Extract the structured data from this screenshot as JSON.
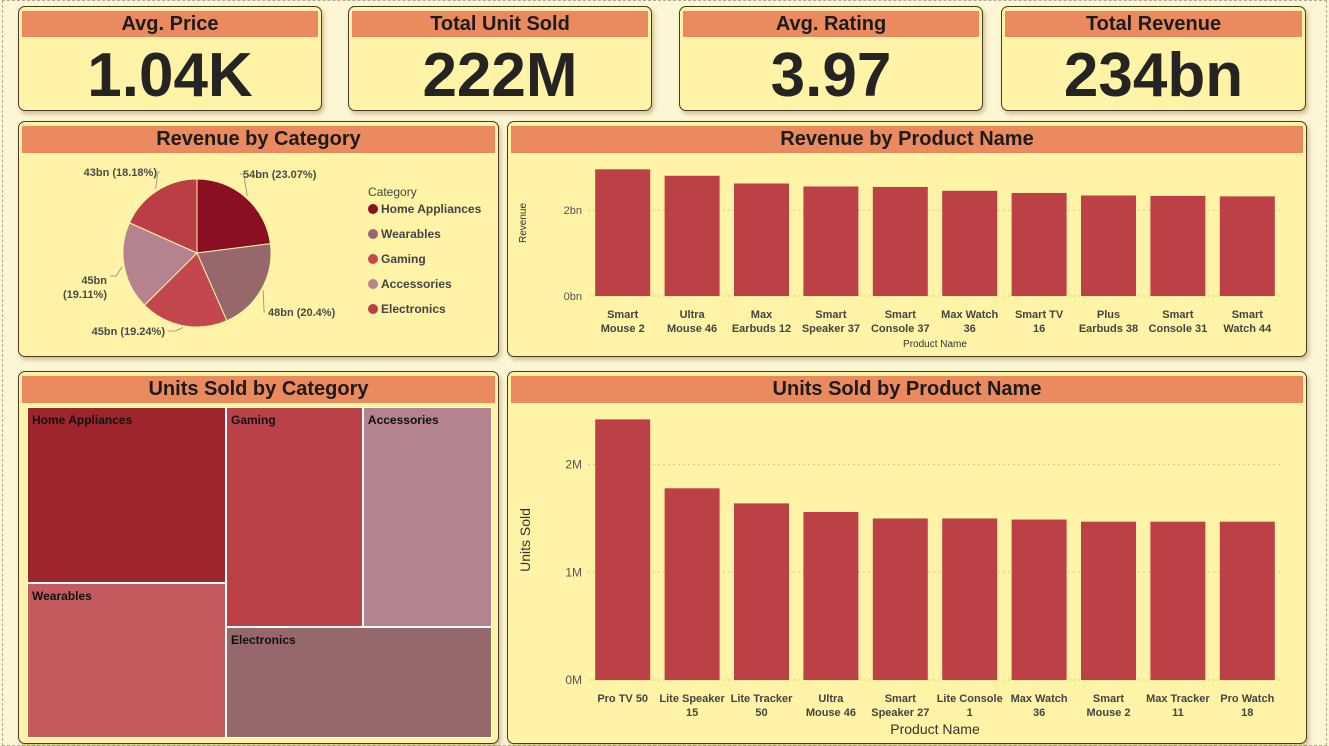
{
  "kpis": [
    {
      "title": "Avg. Price",
      "value": "1.04K"
    },
    {
      "title": "Total Unit Sold",
      "value": "222M"
    },
    {
      "title": "Avg. Rating",
      "value": "3.97"
    },
    {
      "title": "Total Revenue",
      "value": "234bn"
    }
  ],
  "colors": {
    "header": "#EA8A5E",
    "panel": "#FEF3A6",
    "background": "#FDF6D4",
    "bar": "#BC4147",
    "home_appliances": "#8B0F22",
    "wearables": "#96686B",
    "gaming": "#C2484E",
    "accessories": "#B4838E",
    "electronics": "#BA3E43"
  },
  "chart_data": [
    {
      "type": "pie",
      "title": "Revenue by Category",
      "legend_title": "Category",
      "legend_position": "right",
      "categories": [
        "Home Appliances",
        "Wearables",
        "Gaming",
        "Accessories",
        "Electronics"
      ],
      "values": [
        54,
        48,
        45,
        45,
        43
      ],
      "value_labels": [
        "54bn (23.07%)",
        "48bn (20.4%)",
        "45bn (19.24%)",
        "45bn (19.11%)",
        "43bn (18.18%)"
      ],
      "colors": [
        "#8B0F22",
        "#96686B",
        "#C2484E",
        "#B4838E",
        "#BA3E43"
      ]
    },
    {
      "type": "bar",
      "title": "Revenue by Product Name",
      "categories": [
        "Smart Mouse 2",
        "Ultra Mouse 46",
        "Max Earbuds 12",
        "Smart Speaker 37",
        "Smart Console 37",
        "Max Watch 36",
        "Smart TV 16",
        "Plus Earbuds 38",
        "Smart Console 31",
        "Smart Watch 44"
      ],
      "category_lines": [
        [
          "Smart",
          "Mouse 2"
        ],
        [
          "Ultra",
          "Mouse 46"
        ],
        [
          "Max",
          "Earbuds 12"
        ],
        [
          "Smart",
          "Speaker 37"
        ],
        [
          "Smart",
          "Console 37"
        ],
        [
          "Max Watch",
          "36"
        ],
        [
          "Smart TV",
          "16"
        ],
        [
          "Plus",
          "Earbuds 38"
        ],
        [
          "Smart",
          "Console 31"
        ],
        [
          "Smart",
          "Watch 44"
        ]
      ],
      "values": [
        2.95,
        2.8,
        2.62,
        2.55,
        2.54,
        2.45,
        2.4,
        2.34,
        2.33,
        2.32
      ],
      "unit": "bn",
      "xlabel": "Product Name",
      "ylabel": "Revenue",
      "yticks": [
        "0bn",
        "2bn"
      ],
      "ytick_values": [
        0,
        2
      ],
      "ylim": [
        0,
        3.4
      ],
      "grid": true
    },
    {
      "type": "heatmap",
      "subtype": "treemap",
      "title": "Units Sold by Category",
      "categories": [
        "Home Appliances",
        "Wearables",
        "Gaming",
        "Electronics",
        "Accessories"
      ],
      "values": [
        50.5,
        44.5,
        43.5,
        42.5,
        41
      ],
      "colors": [
        "#9E252B",
        "#C45A5E",
        "#BA4148",
        "#96686B",
        "#B4838E"
      ]
    },
    {
      "type": "bar",
      "title": "Units Sold by Product Name",
      "categories": [
        "Pro TV 50",
        "Lite Speaker 15",
        "Lite Tracker 50",
        "Ultra Mouse 46",
        "Smart Speaker 27",
        "Lite Console 1",
        "Max Watch 36",
        "Smart Mouse 2",
        "Max Tracker 11",
        "Pro Watch 18"
      ],
      "category_lines": [
        [
          "Pro TV 50",
          ""
        ],
        [
          "Lite Speaker",
          "15"
        ],
        [
          "Lite Tracker",
          "50"
        ],
        [
          "Ultra",
          "Mouse 46"
        ],
        [
          "Smart",
          "Speaker 27"
        ],
        [
          "Lite Console",
          "1"
        ],
        [
          "Max Watch",
          "36"
        ],
        [
          "Smart",
          "Mouse 2"
        ],
        [
          "Max Tracker",
          "11"
        ],
        [
          "Pro Watch",
          "18"
        ]
      ],
      "values": [
        2.42,
        1.78,
        1.64,
        1.56,
        1.5,
        1.5,
        1.49,
        1.47,
        1.47,
        1.47
      ],
      "unit": "M",
      "xlabel": "Product Name",
      "ylabel": "Units Sold",
      "yticks": [
        "0M",
        "1M",
        "2M"
      ],
      "ytick_values": [
        0,
        1,
        2
      ],
      "ylim": [
        0,
        2.6
      ],
      "grid": true
    }
  ]
}
